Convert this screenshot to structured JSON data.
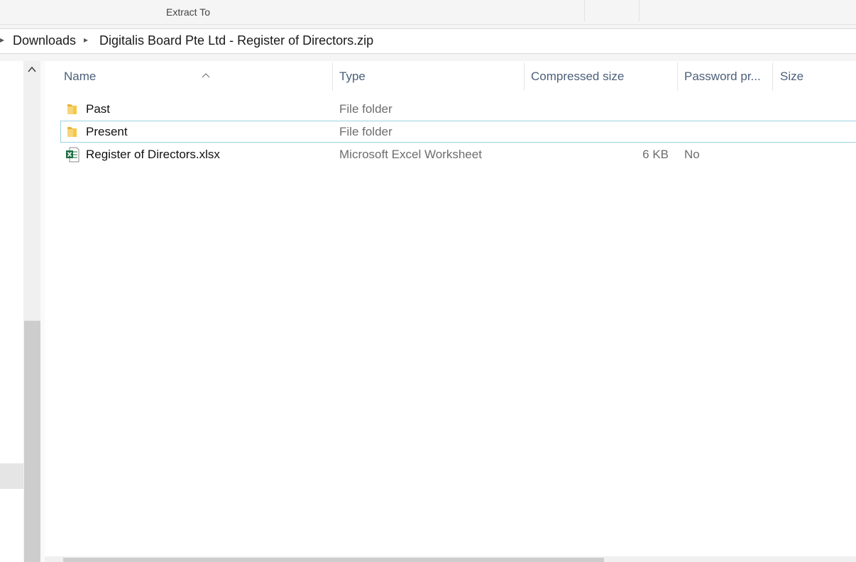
{
  "ribbon": {
    "extract_to_label": "Extract To"
  },
  "breadcrumb": {
    "items": [
      "Downloads",
      "Digitalis Board Pte Ltd - Register of Directors.zip"
    ]
  },
  "columns": {
    "name": "Name",
    "type": "Type",
    "compressed_size": "Compressed size",
    "password": "Password pr...",
    "size": "Size"
  },
  "files": [
    {
      "name": "Past",
      "type": "File folder",
      "compressed_size": "",
      "password": "",
      "icon": "folder-icon"
    },
    {
      "name": "Present",
      "type": "File folder",
      "compressed_size": "",
      "password": "",
      "icon": "folder-icon"
    },
    {
      "name": "Register of Directors.xlsx",
      "type": "Microsoft Excel Worksheet",
      "compressed_size": "6 KB",
      "password": "No",
      "icon": "excel-file-icon"
    }
  ],
  "colors": {
    "folder": "#f5c842",
    "excel_green": "#1d7044",
    "focus_border": "#99d1e3",
    "header_text": "#4c607a"
  }
}
